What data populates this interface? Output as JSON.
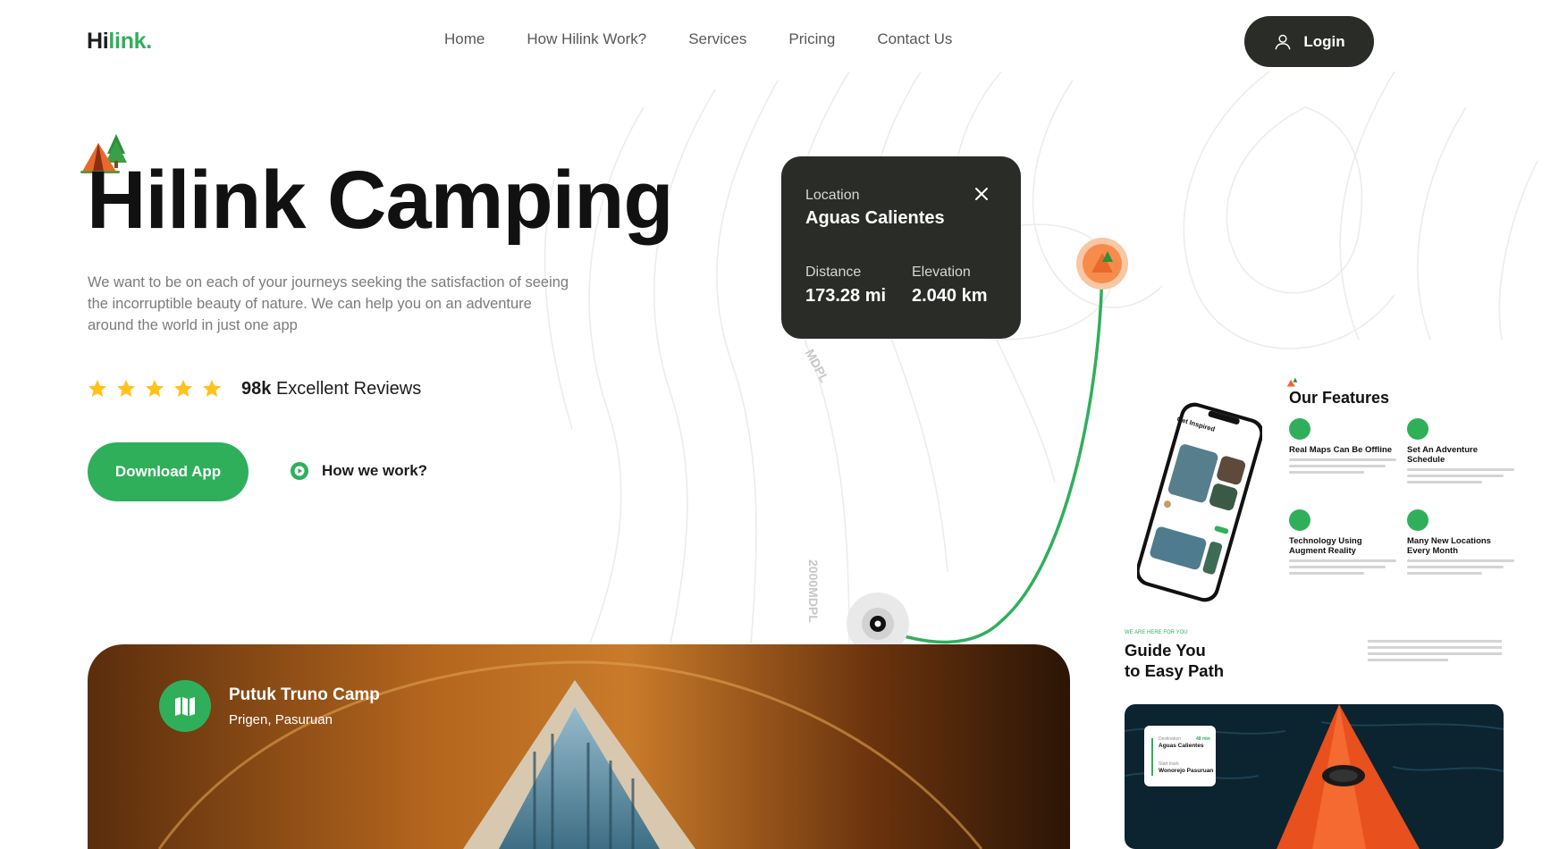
{
  "header": {
    "logo_prefix": "Hi",
    "logo_suffix": "link.",
    "nav": [
      "Home",
      "How Hilink Work?",
      "Services",
      "Pricing",
      "Contact Us"
    ],
    "login_label": "Login"
  },
  "hero": {
    "title": "Hilink Camping",
    "description": "We want to be on each of your journeys seeking the satisfaction of seeing the incorruptible beauty of nature. We can help you on an adventure around the world in just one app",
    "rating_stars": 5,
    "reviews_count": "98k",
    "reviews_label": "Excellent Reviews",
    "download_label": "Download App",
    "how_label": "How we work?"
  },
  "map": {
    "contour_labels": [
      "MDPL",
      "2000MDPL"
    ]
  },
  "location_card": {
    "location_label": "Location",
    "location_name": "Aguas Calientes",
    "distance_label": "Distance",
    "distance_value": "173.28 mi",
    "elevation_label": "Elevation",
    "elevation_value": "2.040 km"
  },
  "camp": {
    "name": "Putuk Truno Camp",
    "location": "Prigen, Pasuruan"
  },
  "preview": {
    "features_title": "Our Features",
    "features": [
      {
        "title": "Real Maps Can Be Offline"
      },
      {
        "title": "Set An Adventure Schedule"
      },
      {
        "title": "Technology Using Augment Reality"
      },
      {
        "title": "Many New Locations Every Month"
      }
    ],
    "phone_heading": "Get Inspired",
    "guide_small": "WE ARE HERE FOR YOU",
    "guide_title_line1": "Guide You",
    "guide_title_line2": "to Easy Path",
    "mini_card": {
      "label1": "Destination",
      "value1": "Aguas Calientes",
      "badge": "48 min",
      "label2": "Start track",
      "value2": "Wonorejo Pasuruan"
    }
  },
  "colors": {
    "accent_green": "#30af5b",
    "dark": "#292c27",
    "star": "#ffc21b",
    "pin_orange": "#f68c4c"
  }
}
